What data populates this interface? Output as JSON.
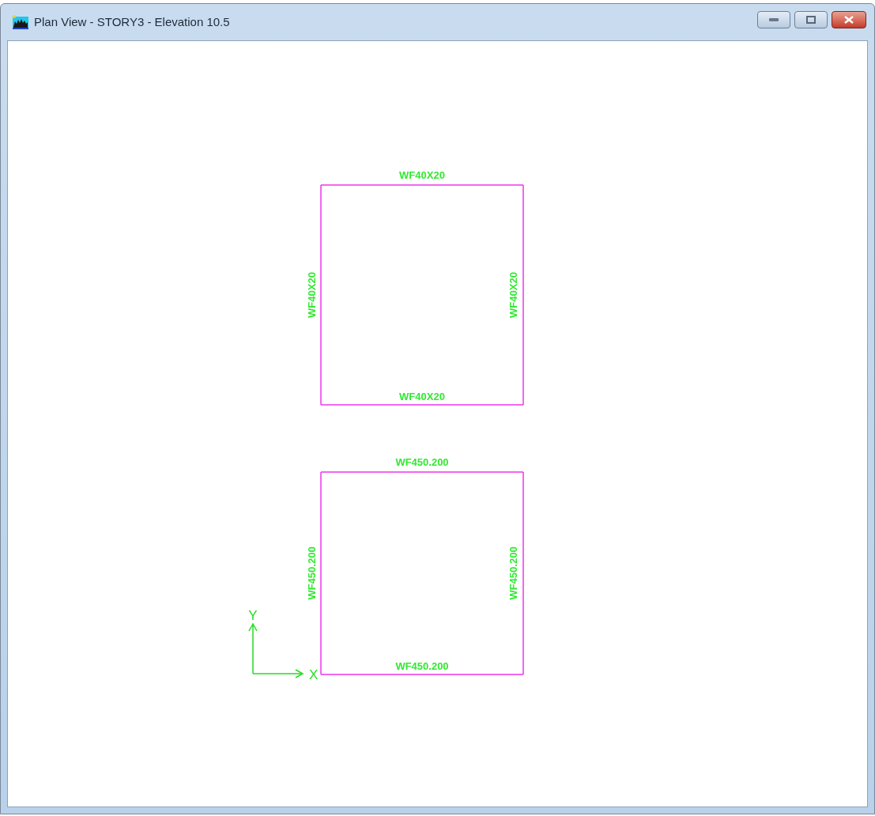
{
  "window": {
    "title": "Plan View - STORY3 - Elevation 10.5"
  },
  "frames": [
    {
      "beams": [
        {
          "kind": "top",
          "label": "WF40X20"
        },
        {
          "kind": "left",
          "label": "WF40X20"
        },
        {
          "kind": "right",
          "label": "WF40X20"
        },
        {
          "kind": "bottom",
          "label": "WF40X20"
        }
      ]
    },
    {
      "beams": [
        {
          "kind": "top",
          "label": "WF450.200"
        },
        {
          "kind": "left",
          "label": "WF450.200"
        },
        {
          "kind": "right",
          "label": "WF450.200"
        },
        {
          "kind": "bottom",
          "label": "WF450.200"
        }
      ]
    }
  ],
  "axes": {
    "x_label": "X",
    "y_label": "Y"
  }
}
